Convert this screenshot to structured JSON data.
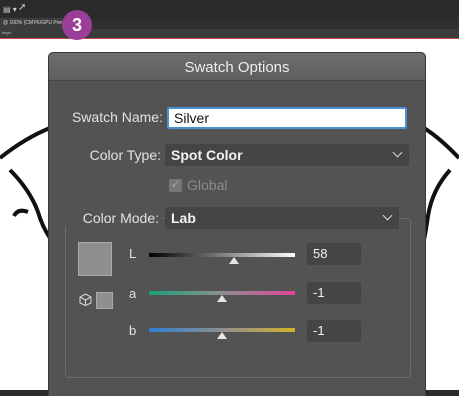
{
  "app": {
    "doc_tab": "@ 100% (CMYK/GPU Preview)",
    "ruler_label": "kegin"
  },
  "dialog": {
    "step_badge": "3",
    "title": "Swatch Options",
    "swatch_name": {
      "label": "Swatch Name:",
      "value": "Silver"
    },
    "color_type": {
      "label": "Color Type:",
      "value": "Spot Color"
    },
    "global": {
      "label": "Global",
      "checked": true,
      "enabled": false
    },
    "color_mode": {
      "label": "Color Mode:",
      "value": "Lab"
    },
    "swatch_color": "#8d8f90",
    "channels": [
      {
        "name": "L",
        "value": "58",
        "slider_position": 0.58
      },
      {
        "name": "a",
        "value": "-1",
        "slider_position": 0.5
      },
      {
        "name": "b",
        "value": "-1",
        "slider_position": 0.5
      }
    ]
  },
  "colors": {
    "dialog_bg": "#535353",
    "input_focus": "#4a90d9",
    "badge": "#9b3e97",
    "guide_line": "#c94a4a"
  }
}
